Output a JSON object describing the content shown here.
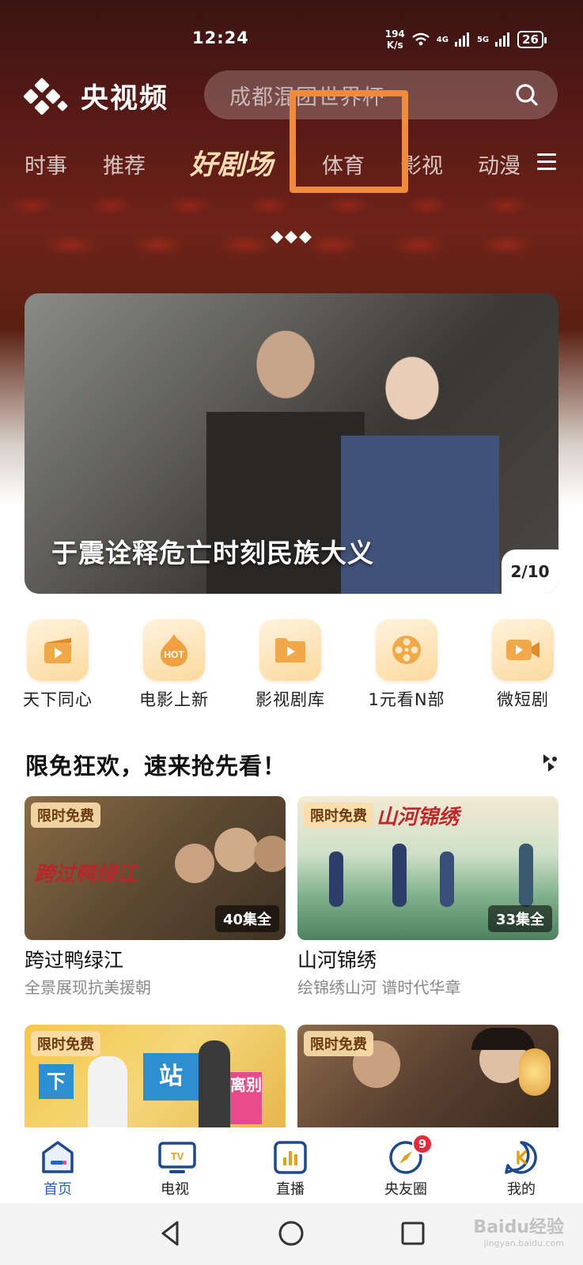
{
  "status_bar": {
    "time": "12:24",
    "net_speed": "194",
    "net_unit": "K/s",
    "signal1": "4G",
    "signal2": "5G",
    "battery": "26"
  },
  "header": {
    "app_name": "央视频",
    "search_placeholder": "成都混团世界杯"
  },
  "tabs": [
    "时事",
    "推荐",
    "好剧场",
    "体育",
    "影视",
    "动漫"
  ],
  "active_tab": "好剧场",
  "banner": {
    "caption": "于震诠释危亡时刻民族大义",
    "page": "2/10"
  },
  "quick_icons": [
    {
      "label": "天下同心",
      "icon": "clapper-icon"
    },
    {
      "label": "电影上新",
      "icon": "hot-icon",
      "icon_text": "HOT"
    },
    {
      "label": "影视剧库",
      "icon": "folder-play-icon"
    },
    {
      "label": "1元看N部",
      "icon": "film-reel-icon"
    },
    {
      "label": "微短剧",
      "icon": "video-camera-icon"
    }
  ],
  "section": {
    "title": "限免狂欢，速来抢先看！"
  },
  "cards": [
    {
      "badge": "限时免费",
      "episodes": "40集全",
      "title": "跨过鸭绿江",
      "subtitle": "全景展现抗美援朝",
      "poster_text": "跨过鸭绿江"
    },
    {
      "badge": "限时免费",
      "episodes": "33集全",
      "title": "山河锦绣",
      "subtitle": "绘锦绣山河 谱时代华章",
      "poster_text": "山河锦绣"
    },
    {
      "badge": "限时免费",
      "poster_text_a": "下",
      "poster_text_b": "站",
      "poster_text_c": "离别"
    },
    {
      "badge": "限时免费"
    }
  ],
  "bottom_nav": [
    {
      "label": "首页",
      "active": true
    },
    {
      "label": "电视",
      "icon_text": "TV"
    },
    {
      "label": "直播"
    },
    {
      "label": "央友圈",
      "badge": "9"
    },
    {
      "label": "我的"
    }
  ],
  "watermark": {
    "text": "Baidu经验",
    "sub": "jingyan.baidu.com"
  },
  "colors": {
    "accent_blue": "#1e63c8",
    "highlight_orange": "#f08a3c",
    "active_tab": "#f7dcb4",
    "badge_red": "#e62a3a"
  }
}
